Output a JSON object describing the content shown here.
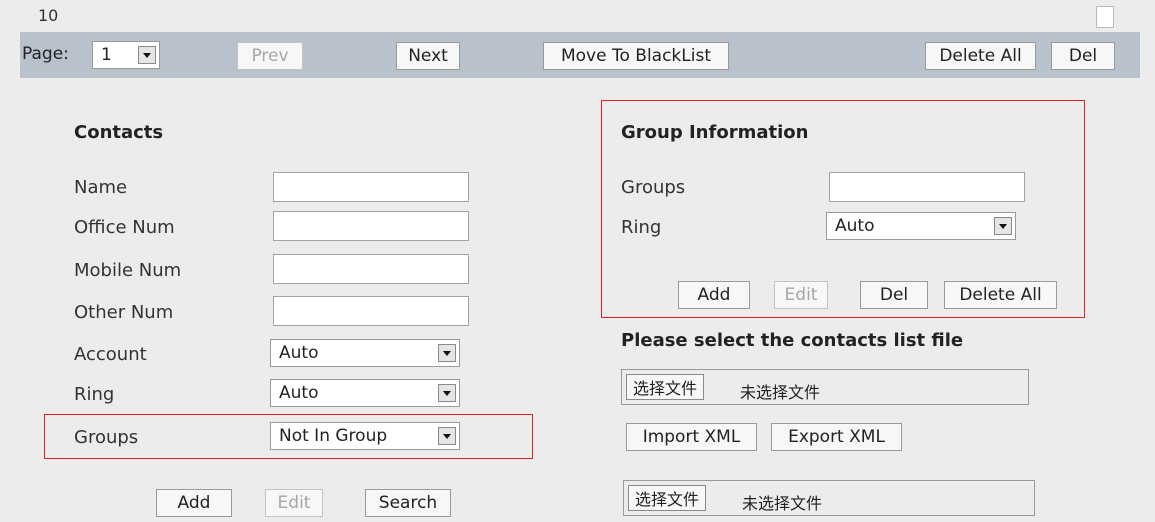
{
  "list": {
    "last_row_number": "10"
  },
  "pager": {
    "page_label": "Page:",
    "page_value": "1",
    "prev_label": "Prev",
    "next_label": "Next",
    "blacklist_label": "Move To BlackList",
    "delete_all_label": "Delete All",
    "del_label": "Del"
  },
  "contacts": {
    "heading": "Contacts",
    "fields": {
      "name": {
        "label": "Name",
        "value": ""
      },
      "office": {
        "label": "Office Num",
        "value": ""
      },
      "mobile": {
        "label": "Mobile Num",
        "value": ""
      },
      "other": {
        "label": "Other Num",
        "value": ""
      },
      "account": {
        "label": "Account",
        "value": "Auto"
      },
      "ring": {
        "label": "Ring",
        "value": "Auto"
      },
      "groups": {
        "label": "Groups",
        "value": "Not In Group"
      }
    },
    "buttons": {
      "add": "Add",
      "edit": "Edit",
      "search": "Search"
    }
  },
  "group_info": {
    "heading": "Group Information",
    "groups_label": "Groups",
    "groups_value": "",
    "ring_label": "Ring",
    "ring_value": "Auto",
    "buttons": {
      "add": "Add",
      "edit": "Edit",
      "del": "Del",
      "delete_all": "Delete All"
    }
  },
  "file_section": {
    "heading": "Please select the contacts list file",
    "choose_file_label": "选择文件",
    "no_file_text": "未选择文件",
    "import_label": "Import XML",
    "export_label": "Export XML"
  },
  "colors": {
    "highlight_border": "#e02020",
    "pager_bg": "#b9c1cc"
  }
}
